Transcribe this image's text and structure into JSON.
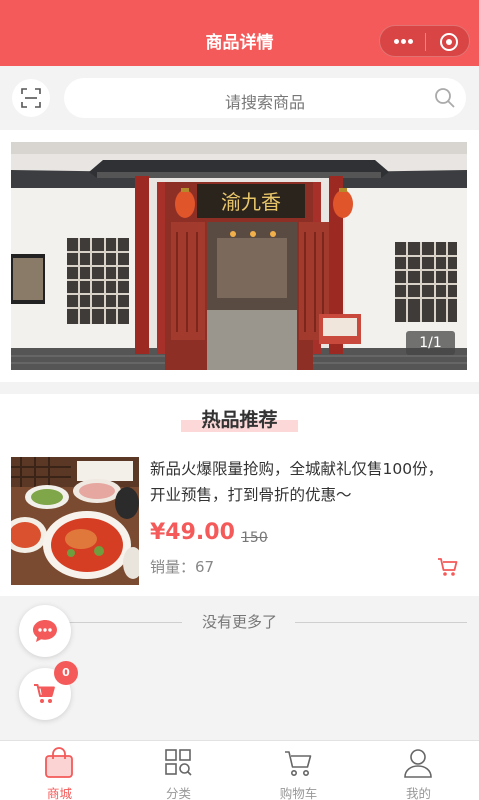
{
  "nav": {
    "title": "商品详情"
  },
  "search": {
    "placeholder": "请搜索商品"
  },
  "banner": {
    "pager": "1/1"
  },
  "section": {
    "title": "热品推荐"
  },
  "product": {
    "name": "新品火爆限量抢购，全城献礼仅售100份，开业预售，打到骨折的优惠～",
    "price": "¥49.00",
    "old_price": "150",
    "sales": "销量：67"
  },
  "footer": {
    "no_more": "没有更多了"
  },
  "float_cart": {
    "badge": "0"
  },
  "tabs": [
    {
      "label": "商城",
      "icon": "shop-bag-icon",
      "active": true
    },
    {
      "label": "分类",
      "icon": "category-grid-icon",
      "active": false
    },
    {
      "label": "购物车",
      "icon": "cart-icon",
      "active": false
    },
    {
      "label": "我的",
      "icon": "user-icon",
      "active": false
    }
  ],
  "colors": {
    "accent": "#f45a59",
    "background": "#f3f3f3"
  }
}
